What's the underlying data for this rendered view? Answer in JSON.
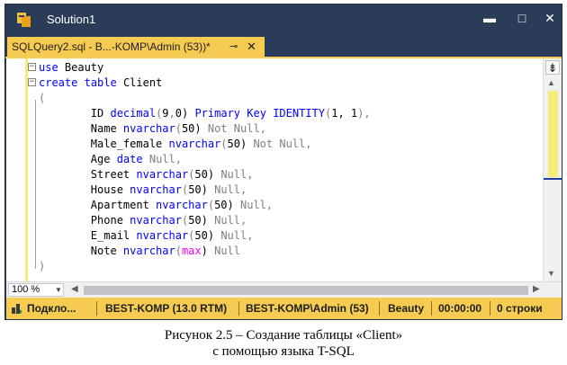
{
  "window": {
    "title": "Solution1",
    "minimize_glyph": "▬",
    "maximize_glyph": "□",
    "close_glyph": "✕"
  },
  "tab": {
    "label": "SQLQuery2.sql - B...-KOMP\\Admin (53))*",
    "pin_glyph": "⊸",
    "close_glyph": "✕"
  },
  "code": {
    "lines": [
      [
        "use Beauty"
      ],
      [
        "create table Client"
      ],
      [
        "("
      ],
      [
        "ID decimal(9,0) Primary Key IDENTITY(1, 1),"
      ],
      [
        "Name nvarchar(50) Not Null,"
      ],
      [
        "Male_female nvarchar(50) Not Null,"
      ],
      [
        "Age date Null,"
      ],
      [
        "Street nvarchar(50) Null,"
      ],
      [
        "House nvarchar(50) Null,"
      ],
      [
        "Apartment nvarchar(50) Null,"
      ],
      [
        "Phone nvarchar(50) Null,"
      ],
      [
        "E_mail nvarchar(50) Null,"
      ],
      [
        "Note nvarchar(max) Null"
      ],
      [
        ")"
      ]
    ]
  },
  "zoom": {
    "value": "100 %"
  },
  "status": {
    "connection": "Подкло...",
    "server": "BEST-KOMP (13.0 RTM)",
    "user": "BEST-KOMP\\Admin (53)",
    "database": "Beauty",
    "time": "00:00:00",
    "rows": "0 строки"
  },
  "caption": {
    "line1": "Рисунок 2.5 – Создание таблицы «Client»",
    "line2": "с помощью языка T-SQL"
  },
  "colors": {
    "title_bar": "#2b3c59",
    "accent_yellow": "#f5cc51",
    "keyword_blue": "#0000ff",
    "null_gray": "#808080",
    "function_pink": "#ff00ff"
  }
}
